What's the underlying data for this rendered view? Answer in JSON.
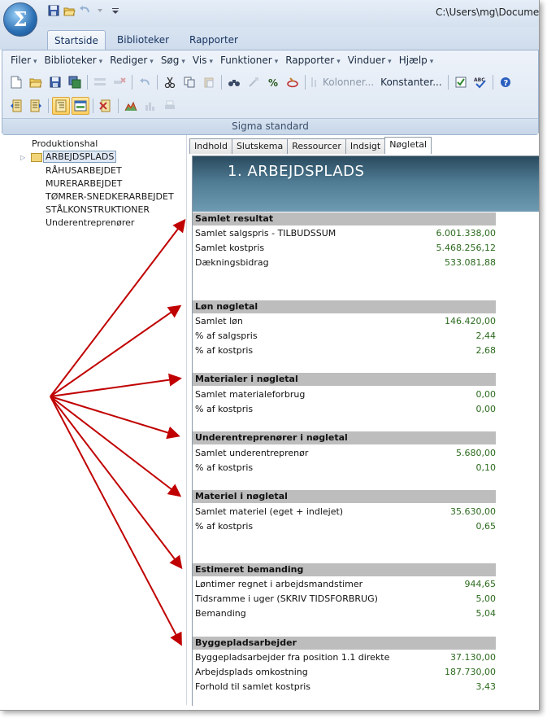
{
  "window": {
    "title": "C:\\Users\\mg\\Docume"
  },
  "orb": {
    "glyph": "Σ"
  },
  "ribbon_tabs": [
    "Startside",
    "Biblioteker",
    "Rapporter"
  ],
  "menus": [
    "Filer",
    "Biblioteker",
    "Rediger",
    "Søg",
    "Vis",
    "Funktioner",
    "Rapporter",
    "Vinduer",
    "Hjælp"
  ],
  "toolbar": {
    "kolonner_label": "Kolonner...",
    "konstanter_label": "Konstanter..."
  },
  "ribbon_group": {
    "label": "Sigma standard"
  },
  "tree": {
    "root": "Produktionshal",
    "selected": "ARBEJDSPLADS",
    "children": [
      "RÅHUSARBEJDET",
      "MURERARBEJDET",
      "TØMRER-SNEDKERARBEJDET",
      "STÅLKONSTRUKTIONER",
      "Underentreprenører"
    ]
  },
  "content_tabs": [
    "Indhold",
    "Slutskema",
    "Ressourcer",
    "Indsigt",
    "Nøgletal"
  ],
  "report": {
    "title": "1.  ARBEJDSPLADS",
    "sections": [
      {
        "heading": "Samlet resultat",
        "rows": [
          {
            "label": "Samlet salgspris - TILBUDSSUM",
            "value": "6.001.338,00"
          },
          {
            "label": "Samlet kostpris",
            "value": "5.468.256,12"
          },
          {
            "label": "Dækningsbidrag",
            "value": "533.081,88"
          }
        ]
      },
      {
        "heading": "Løn nøgletal",
        "rows": [
          {
            "label": "Samlet løn",
            "value": "146.420,00"
          },
          {
            "label": "% af salgspris",
            "value": "2,44"
          },
          {
            "label": "% af kostpris",
            "value": "2,68"
          }
        ]
      },
      {
        "heading": "Materialer i nøgletal",
        "rows": [
          {
            "label": "Samlet materialeforbrug",
            "value": "0,00"
          },
          {
            "label": "% af kostpris",
            "value": "0,00"
          }
        ]
      },
      {
        "heading": "Underentreprenører i nøgletal",
        "rows": [
          {
            "label": "Samlet underentreprenør",
            "value": "5.680,00"
          },
          {
            "label": "% af kostpris",
            "value": "0,10"
          }
        ]
      },
      {
        "heading": "Materiel i nøgletal",
        "rows": [
          {
            "label": "Samlet materiel (eget + indlejet)",
            "value": "35.630,00"
          },
          {
            "label": "% af kostpris",
            "value": "0,65"
          }
        ]
      },
      {
        "heading": "Estimeret bemanding",
        "rows": [
          {
            "label": "Løntimer regnet i arbejdsmandstimer",
            "value": "944,65"
          },
          {
            "label": "Tidsramme i uger (SKRIV TIDSFORBRUG)",
            "value": "5,00"
          },
          {
            "label": "Bemanding",
            "value": "5,04"
          }
        ]
      },
      {
        "heading": "Byggepladsarbejder",
        "rows": [
          {
            "label": "Byggepladsarbejder fra position 1.1 direkte",
            "value": "37.130,00"
          },
          {
            "label": "Arbejdsplads omkostning",
            "value": "187.730,00"
          },
          {
            "label": "Forhold til samlet kostpris",
            "value": "3,43"
          }
        ]
      }
    ]
  },
  "colors": {
    "accent": "#2a4a5e",
    "value_text": "#2c6b1e",
    "section_bg": "#bdbdbd",
    "arrow": "#c00000"
  }
}
